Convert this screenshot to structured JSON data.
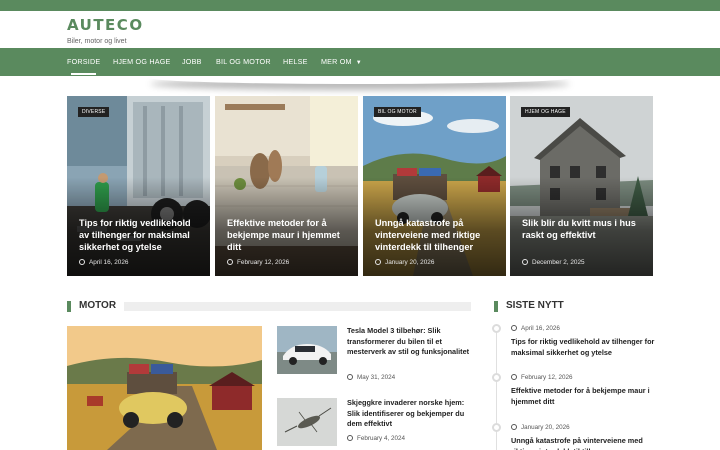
{
  "site": {
    "title": "AUTECO",
    "tagline": "Biler, motor og livet",
    "colors": {
      "brand": "#5a8a5e",
      "badge": "#222222"
    }
  },
  "nav": {
    "items": [
      "FORSIDE",
      "HJEM OG HAGE",
      "JOBB",
      "BIL OG MOTOR",
      "HELSE",
      "MER OM"
    ],
    "active": "FORSIDE",
    "more_icon": "chevron-down-icon"
  },
  "featured": [
    {
      "badge": "DIVERSE",
      "title": "Tips for riktig vedlikehold av tilhenger for maksimal sikkerhet og ytelse",
      "date": "April 16, 2026"
    },
    {
      "badge": "",
      "title": "Effektive metoder for å bekjempe maur i hjemmet ditt",
      "date": "February 12, 2026"
    },
    {
      "badge": "BIL OG MOTOR",
      "title": "Unngå katastrofe på vinterveiene med riktige vinterdekk til tilhenger",
      "date": "January 20, 2026"
    },
    {
      "badge": "HJEM OG HAGE",
      "title": "Slik blir du kvitt mus i hus raskt og effektivt",
      "date": "December 2, 2025"
    }
  ],
  "motor": {
    "heading": "MOTOR",
    "list": [
      {
        "title": "Tesla Model 3 tilbehør: Slik transformerer du bilen til et mesterverk av stil og funksjonalitet",
        "date": "May 31, 2024"
      },
      {
        "title": "Skjeggkre invaderer norske hjem: Slik identifiserer og bekjemper du dem effektivt",
        "date": "February 4, 2024"
      }
    ]
  },
  "latest": {
    "heading": "SISTE NYTT",
    "items": [
      {
        "date": "April 16, 2026",
        "title": "Tips for riktig vedlikehold av tilhenger for maksimal sikkerhet og ytelse"
      },
      {
        "date": "February 12, 2026",
        "title": "Effektive metoder for å bekjempe maur i hjemmet ditt"
      },
      {
        "date": "January 20, 2026",
        "title": "Unngå katastrofe på vinterveiene med riktige vinterdekk til tilhenger"
      }
    ]
  }
}
